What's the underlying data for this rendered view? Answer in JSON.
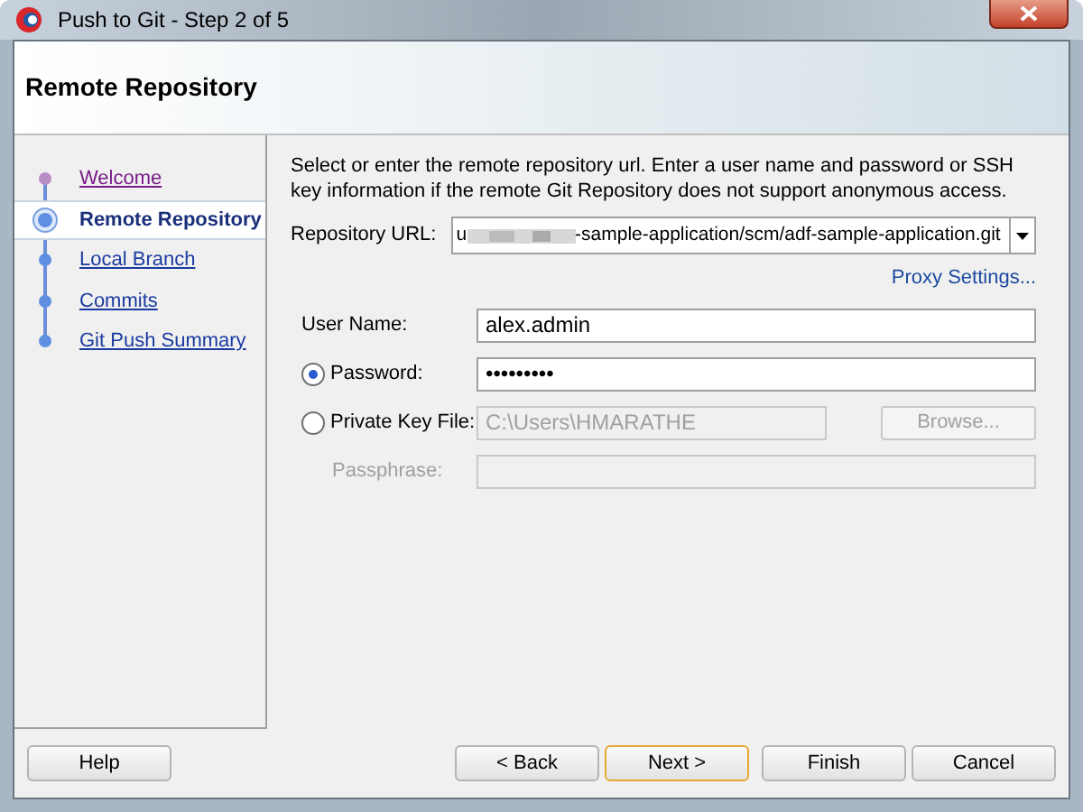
{
  "window": {
    "title": "Push to Git - Step 2 of 5"
  },
  "header": {
    "title": "Remote Repository"
  },
  "steps": [
    {
      "label": "Welcome",
      "selected": false,
      "visited": true
    },
    {
      "label": "Remote Repository",
      "selected": true,
      "visited": false
    },
    {
      "label": "Local Branch",
      "selected": false,
      "visited": false
    },
    {
      "label": "Commits",
      "selected": false,
      "visited": false
    },
    {
      "label": "Git Push Summary",
      "selected": false,
      "visited": false
    }
  ],
  "description": "Select or enter the remote repository url. Enter a user name and password or SSH key information if the remote Git Repository does not support anonymous access.",
  "repository_url": {
    "label": "Repository URL:",
    "value_start": "u",
    "value_end": "-sample-application/scm/adf-sample-application.git"
  },
  "proxy_link": "Proxy Settings...",
  "user_name": {
    "label": "User Name:",
    "value": "alex.admin"
  },
  "auth": [
    {
      "label": "Password:",
      "selected": true,
      "value": "•••••••••",
      "disabled": false
    },
    {
      "label": "Private Key File:",
      "selected": false,
      "value": "C:\\Users\\HMARATHE",
      "disabled": true,
      "button": "Browse..."
    }
  ],
  "passphrase": {
    "label": "Passphrase:",
    "disabled": true
  },
  "buttons": [
    {
      "label": "Help",
      "focused": false
    },
    {
      "label": "< Back",
      "focused": false
    },
    {
      "label": "Next >",
      "focused": true
    },
    {
      "label": "Finish",
      "focused": false
    },
    {
      "label": "Cancel",
      "focused": false
    }
  ]
}
